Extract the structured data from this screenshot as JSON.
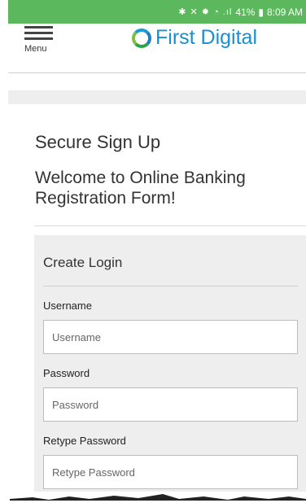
{
  "status_bar": {
    "icons": "✱ ✕ ✹ ◔ .ıl",
    "battery": "41%",
    "time": "8:09 AM",
    "color": "#5cb85c"
  },
  "header": {
    "menu_label": "Menu",
    "brand_name": "First Digital",
    "brand_color": "#1a8fd0"
  },
  "page": {
    "title": "Secure Sign Up",
    "welcome": "Welcome to Online Banking Registration Form!"
  },
  "form": {
    "section_title": "Create Login",
    "fields": [
      {
        "label": "Username",
        "placeholder": "Username",
        "value": ""
      },
      {
        "label": "Password",
        "placeholder": "Password",
        "value": ""
      },
      {
        "label": "Retype Password",
        "placeholder": "Retype Password",
        "value": ""
      }
    ]
  }
}
